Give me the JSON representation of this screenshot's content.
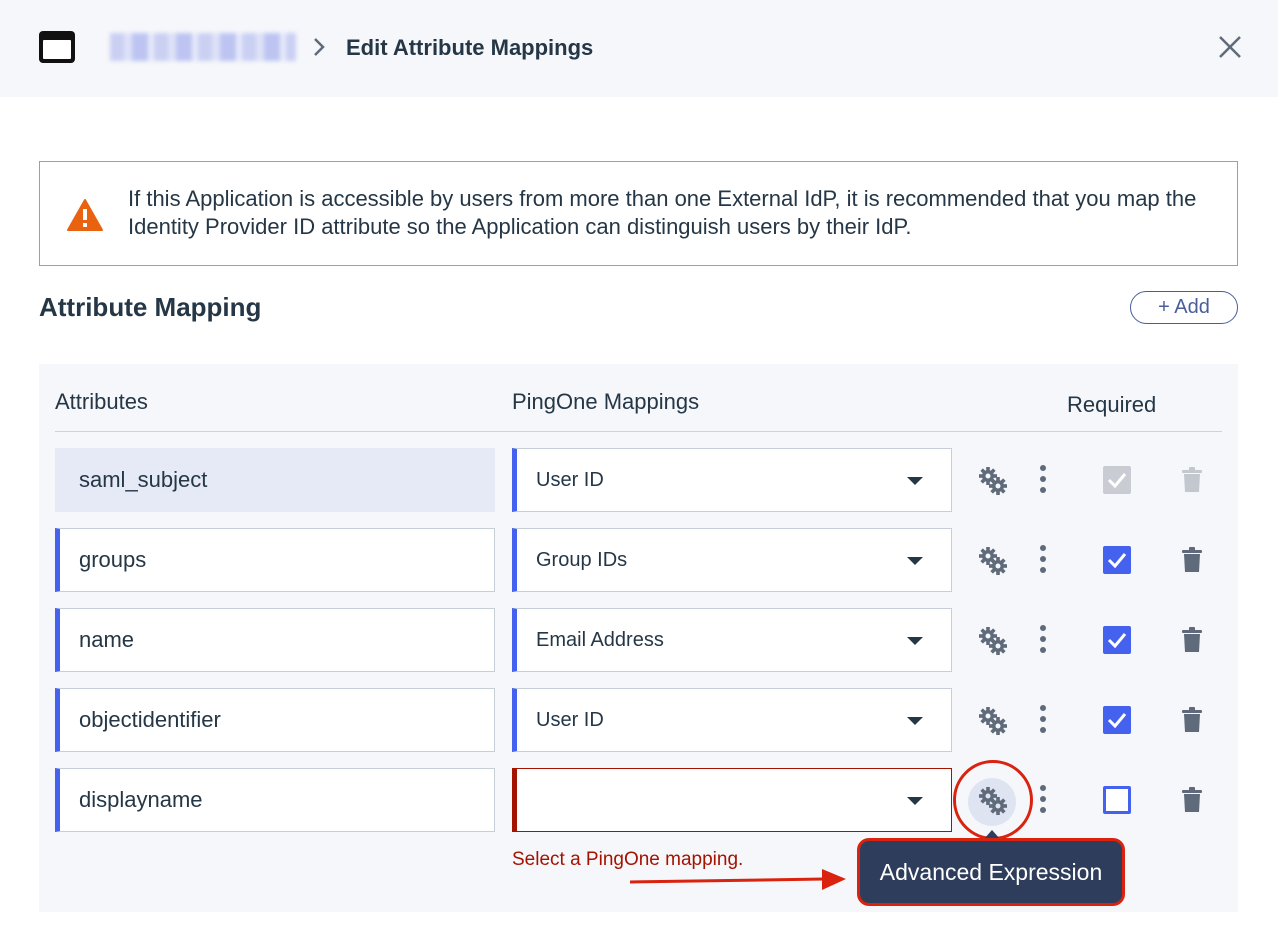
{
  "header": {
    "title": "Edit Attribute Mappings",
    "icons": {
      "app": "app-window-icon",
      "separator": "chevron-right-icon",
      "close": "close-icon"
    }
  },
  "warning": {
    "icon": "warning-triangle-icon",
    "text": "If this Application is accessible by users from more than one External IdP, it is recommended that you map the Identity Provider ID attribute so the Application can distinguish users by their IdP."
  },
  "section": {
    "title": "Attribute Mapping",
    "add_label": "+ Add"
  },
  "table": {
    "headers": {
      "attributes": "Attributes",
      "mappings": "PingOne Mappings",
      "required": "Required"
    },
    "rows": [
      {
        "attribute": "saml_subject",
        "mapping": "User ID",
        "required": true,
        "locked": true
      },
      {
        "attribute": "groups",
        "mapping": "Group IDs",
        "required": true,
        "locked": false
      },
      {
        "attribute": "name",
        "mapping": "Email Address",
        "required": true,
        "locked": false
      },
      {
        "attribute": "objectidentifier",
        "mapping": "User ID",
        "required": true,
        "locked": false
      },
      {
        "attribute": "displayname",
        "mapping": "",
        "required": false,
        "locked": false
      }
    ],
    "error_message": "Select a PingOne mapping."
  },
  "tooltip": {
    "label": "Advanced Expression"
  },
  "colors": {
    "accent": "#4462ed",
    "error": "#a31300",
    "annotation": "#d9230f",
    "warning": "#e8620f"
  }
}
